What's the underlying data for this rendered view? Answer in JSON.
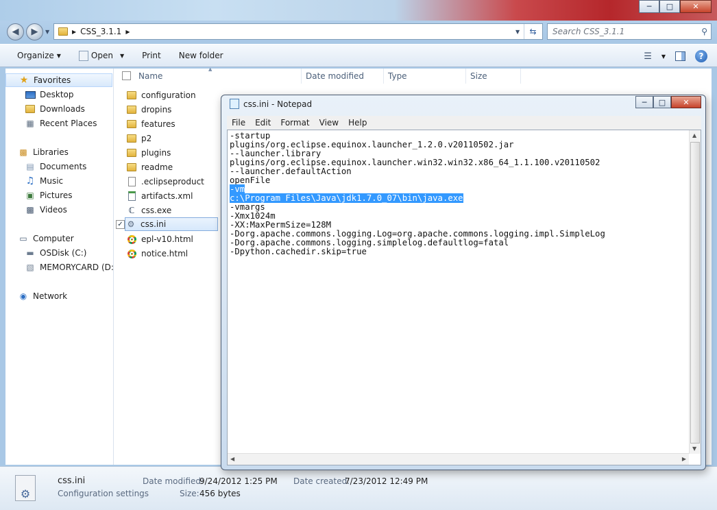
{
  "explorer": {
    "breadcrumb": {
      "folder": "CSS_3.1.1"
    },
    "search": {
      "placeholder": "Search CSS_3.1.1"
    },
    "toolbar": {
      "organize": "Organize",
      "open": "Open",
      "print": "Print",
      "new_folder": "New folder"
    },
    "navpane": {
      "favorites": {
        "label": "Favorites",
        "items": [
          "Desktop",
          "Downloads",
          "Recent Places"
        ]
      },
      "libraries": {
        "label": "Libraries",
        "items": [
          "Documents",
          "Music",
          "Pictures",
          "Videos"
        ]
      },
      "computer": {
        "label": "Computer",
        "items": [
          "OSDisk (C:)",
          "MEMORYCARD (D:)"
        ]
      },
      "network": {
        "label": "Network"
      }
    },
    "columns": {
      "name": "Name",
      "date_modified": "Date modified",
      "type": "Type",
      "size": "Size"
    },
    "files": [
      {
        "name": "configuration",
        "icon": "folder-icon"
      },
      {
        "name": "dropins",
        "icon": "folder-icon"
      },
      {
        "name": "features",
        "icon": "folder-icon"
      },
      {
        "name": "p2",
        "icon": "folder-icon"
      },
      {
        "name": "plugins",
        "icon": "folder-icon"
      },
      {
        "name": "readme",
        "icon": "folder-icon"
      },
      {
        "name": ".eclipseproduct",
        "icon": "file-icon"
      },
      {
        "name": "artifacts.xml",
        "icon": "xml-file-icon"
      },
      {
        "name": "css.exe",
        "icon": "app-icon"
      },
      {
        "name": "css.ini",
        "icon": "settings-file-icon"
      },
      {
        "name": "epl-v10.html",
        "icon": "chrome-icon"
      },
      {
        "name": "notice.html",
        "icon": "chrome-icon"
      }
    ],
    "details": {
      "filename": "css.ini",
      "filetype": "Configuration settings",
      "date_modified_label": "Date modified:",
      "date_modified": "9/24/2012 1:25 PM",
      "size_label": "Size:",
      "size": "456 bytes",
      "date_created_label": "Date created:",
      "date_created": "7/23/2012 12:49 PM"
    }
  },
  "notepad": {
    "title": "css.ini - Notepad",
    "menu": [
      "File",
      "Edit",
      "Format",
      "View",
      "Help"
    ],
    "lines": [
      "-startup",
      "plugins/org.eclipse.equinox.launcher_1.2.0.v20110502.jar",
      "--launcher.library",
      "plugins/org.eclipse.equinox.launcher.win32.win32.x86_64_1.1.100.v20110502",
      "--launcher.defaultAction",
      "openFile",
      "-vm",
      "c:\\Program Files\\Java\\jdk1.7.0_07\\bin\\java.exe",
      "-vmargs",
      "-Xmx1024m",
      "-XX:MaxPermSize=128M",
      "-Dorg.apache.commons.logging.Log=org.apache.commons.logging.impl.SimpleLog",
      "-Dorg.apache.commons.logging.simplelog.defaultlog=fatal",
      "-Dpython.cachedir.skip=true"
    ],
    "highlighted_lines": [
      6,
      7
    ]
  }
}
